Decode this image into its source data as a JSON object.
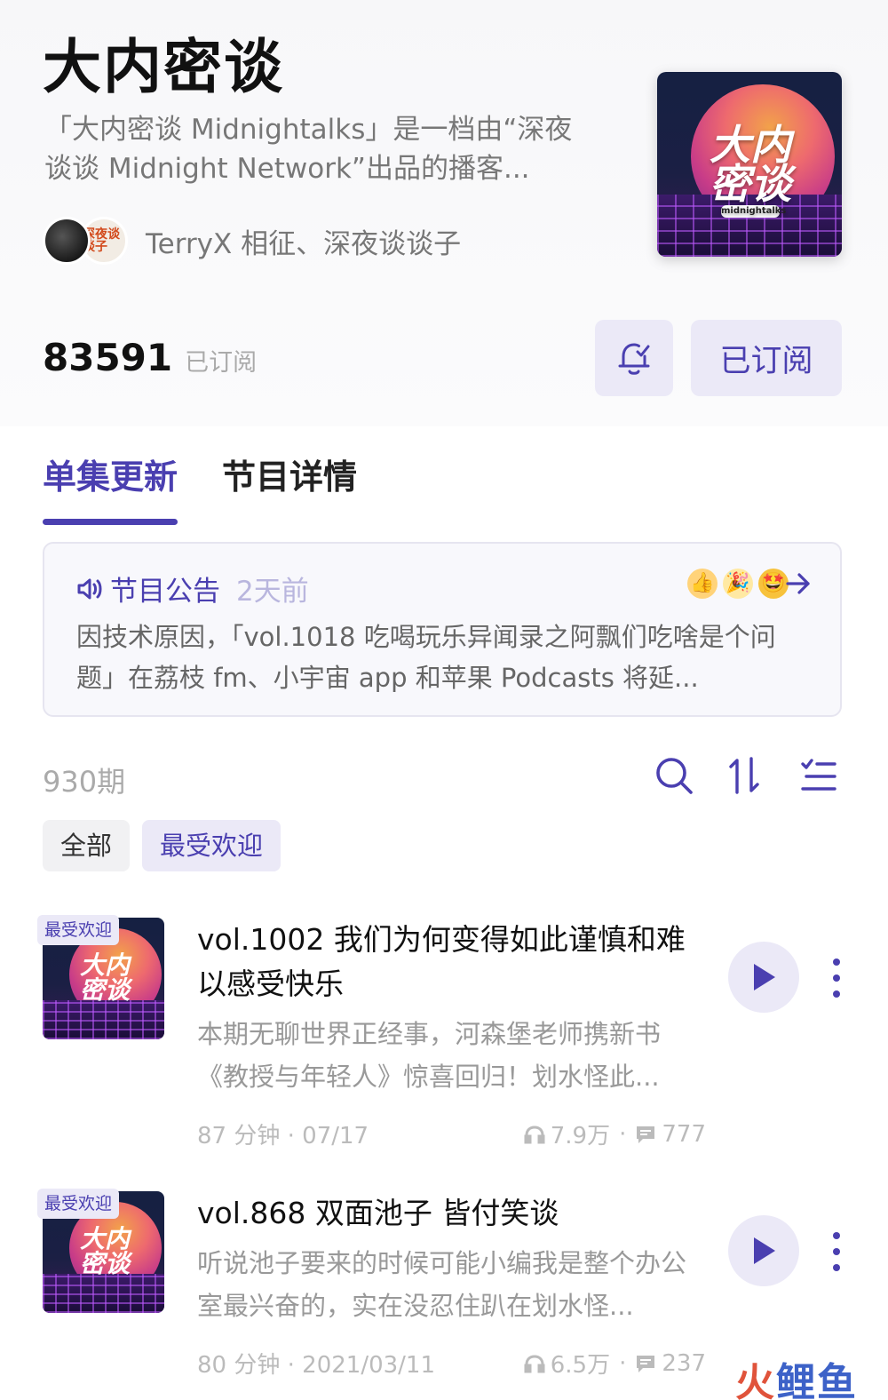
{
  "podcast": {
    "title": "大内密谈",
    "description": "「大内密谈 Midnightalks」是一档由“深夜谈谈 Midnight Network”出品的播客...",
    "hosts_text": "TerryX 相征、深夜谈谈子",
    "cover_logo": "大内密谈",
    "cover_sub": "midnightalks",
    "host2_avatar_text": "深夜谈谈子"
  },
  "subscription": {
    "count": "83591",
    "count_label": "已订阅",
    "subscribe_button": "已订阅",
    "bell_icon": "bell-check-icon"
  },
  "tabs": [
    {
      "label": "单集更新",
      "active": true
    },
    {
      "label": "节目详情",
      "active": false
    }
  ],
  "notice": {
    "title": "节目公告",
    "time": "2天前",
    "body": "因技术原因，「vol.1018 吃喝玩乐异闻录之阿飘们吃啥是个问题」在荔枝 fm、小宇宙 app 和苹果 Podcasts 将延...",
    "emojis": [
      "👍",
      "🎉",
      "🤩"
    ]
  },
  "list": {
    "count": "930期",
    "filters": [
      {
        "label": "全部",
        "selected": false
      },
      {
        "label": "最受欢迎",
        "selected": true
      }
    ],
    "tool_icons": [
      "search-icon",
      "sort-icon",
      "list-filter-icon"
    ]
  },
  "episodes": [
    {
      "badge": "最受欢迎",
      "title": "vol.1002 我们为何变得如此谨慎和难以感受快乐",
      "description": "本期无聊世界正经事，河森堡老师携新书《教授与年轻人》惊喜回归！划水怪此...",
      "duration": "87 分钟",
      "date": "07/17",
      "plays": "7.9万",
      "comments": "777"
    },
    {
      "badge": "最受欢迎",
      "title": "vol.868 双面池子 皆付笑谈",
      "description": "听说池子要来的时候可能小编我是整个办公室最兴奋的，实在没忍住趴在划水怪...",
      "duration": "80 分钟",
      "date": "2021/03/11",
      "plays": "6.5万",
      "comments": "237"
    }
  ],
  "watermark": {
    "part1": "火",
    "part2": "鲤鱼"
  },
  "colors": {
    "accent": "#4a3fb0",
    "accent_bg": "#ebe9f7",
    "muted": "#999999"
  }
}
